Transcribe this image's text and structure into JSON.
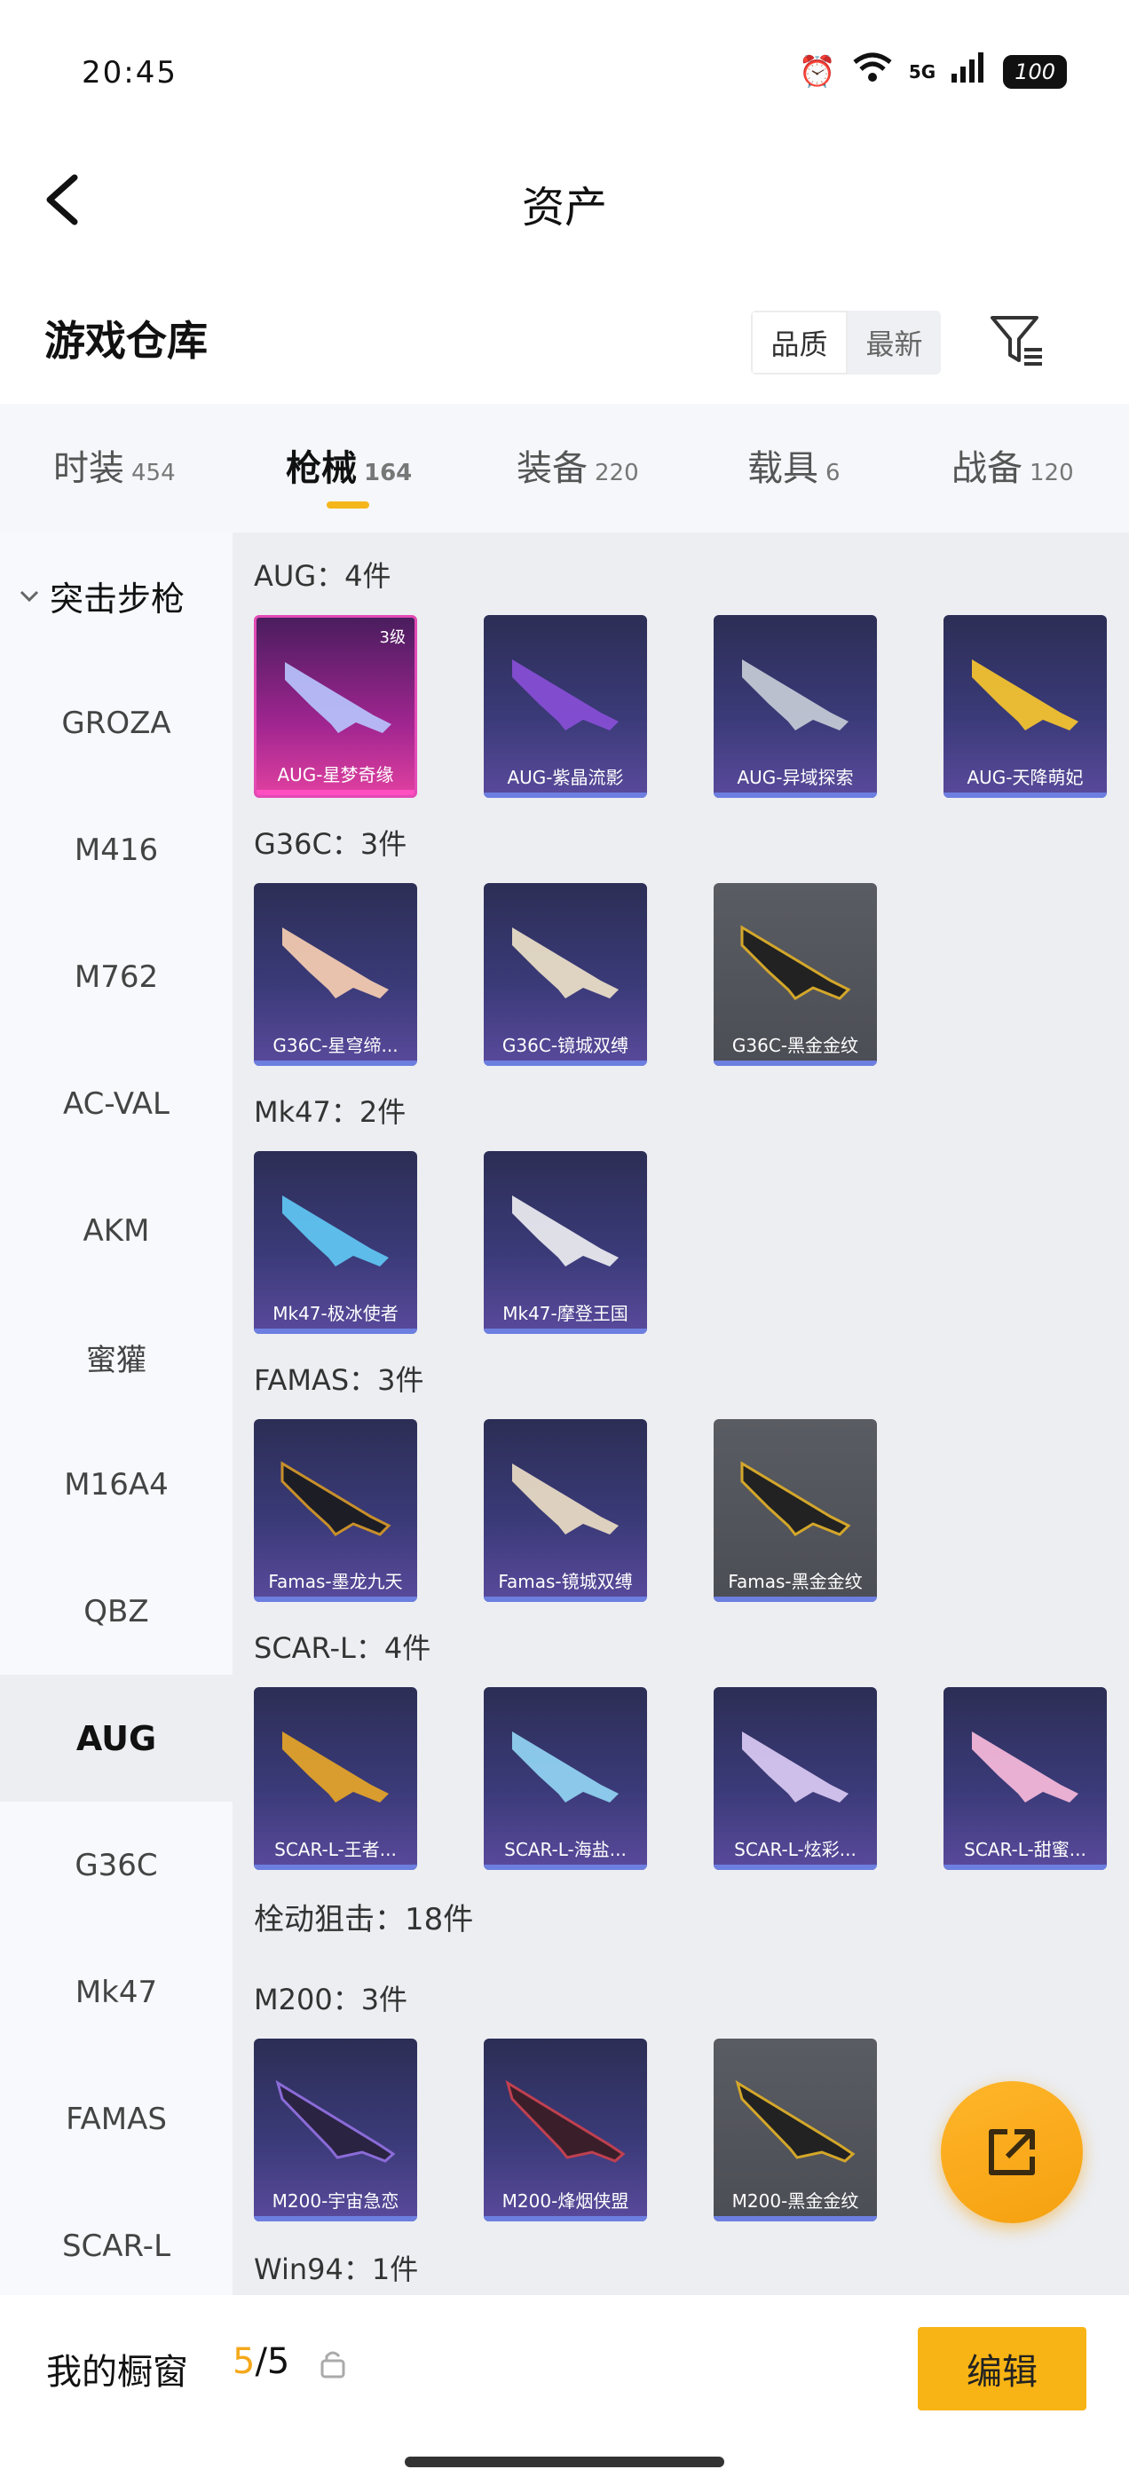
{
  "status": {
    "time": "20:45",
    "network": "5G",
    "battery": "100"
  },
  "nav": {
    "title": "资产"
  },
  "header": {
    "title": "游戏仓库",
    "sort_quality": "品质",
    "sort_newest": "最新"
  },
  "tabs": [
    {
      "label": "时装",
      "count": "454"
    },
    {
      "label": "枪械",
      "count": "164"
    },
    {
      "label": "装备",
      "count": "220"
    },
    {
      "label": "载具",
      "count": "6"
    },
    {
      "label": "战备",
      "count": "120"
    }
  ],
  "sidebar": {
    "category": "突击步枪",
    "items": [
      "GROZA",
      "M416",
      "M762",
      "AC-VAL",
      "AKM",
      "蜜獾",
      "M16A4",
      "QBZ",
      "AUG",
      "G36C",
      "Mk47",
      "FAMAS",
      "SCAR-L"
    ]
  },
  "groups": {
    "aug": {
      "label": "AUG：4件",
      "items": [
        "AUG-星梦奇缘",
        "AUG-紫晶流影",
        "AUG-异域探索",
        "AUG-天降萌妃"
      ],
      "grade": "3级"
    },
    "g36c": {
      "label": "G36C：3件",
      "items": [
        "G36C-星穹缔...",
        "G36C-镜城双缚",
        "G36C-黑金金纹"
      ]
    },
    "mk47": {
      "label": "Mk47：2件",
      "items": [
        "Mk47-极冰使者",
        "Mk47-摩登王国"
      ]
    },
    "famas": {
      "label": "FAMAS：3件",
      "items": [
        "Famas-墨龙九天",
        "Famas-镜城双缚",
        "Famas-黑金金纹"
      ]
    },
    "scarl": {
      "label": "SCAR-L：4件",
      "items": [
        "SCAR-L-王者...",
        "SCAR-L-海盐...",
        "SCAR-L-炫彩...",
        "SCAR-L-甜蜜..."
      ]
    },
    "sniper": {
      "label": "栓动狙击：18件"
    },
    "m200": {
      "label": "M200：3件",
      "items": [
        "M200-宇宙急恋",
        "M200-烽烟侠盟",
        "M200-黑金金纹"
      ]
    },
    "win94": {
      "label": "Win94：1件"
    }
  },
  "bottom": {
    "showcase_label": "我的橱窗",
    "showcase_current": "5",
    "showcase_total": "/5",
    "edit_label": "编辑"
  }
}
